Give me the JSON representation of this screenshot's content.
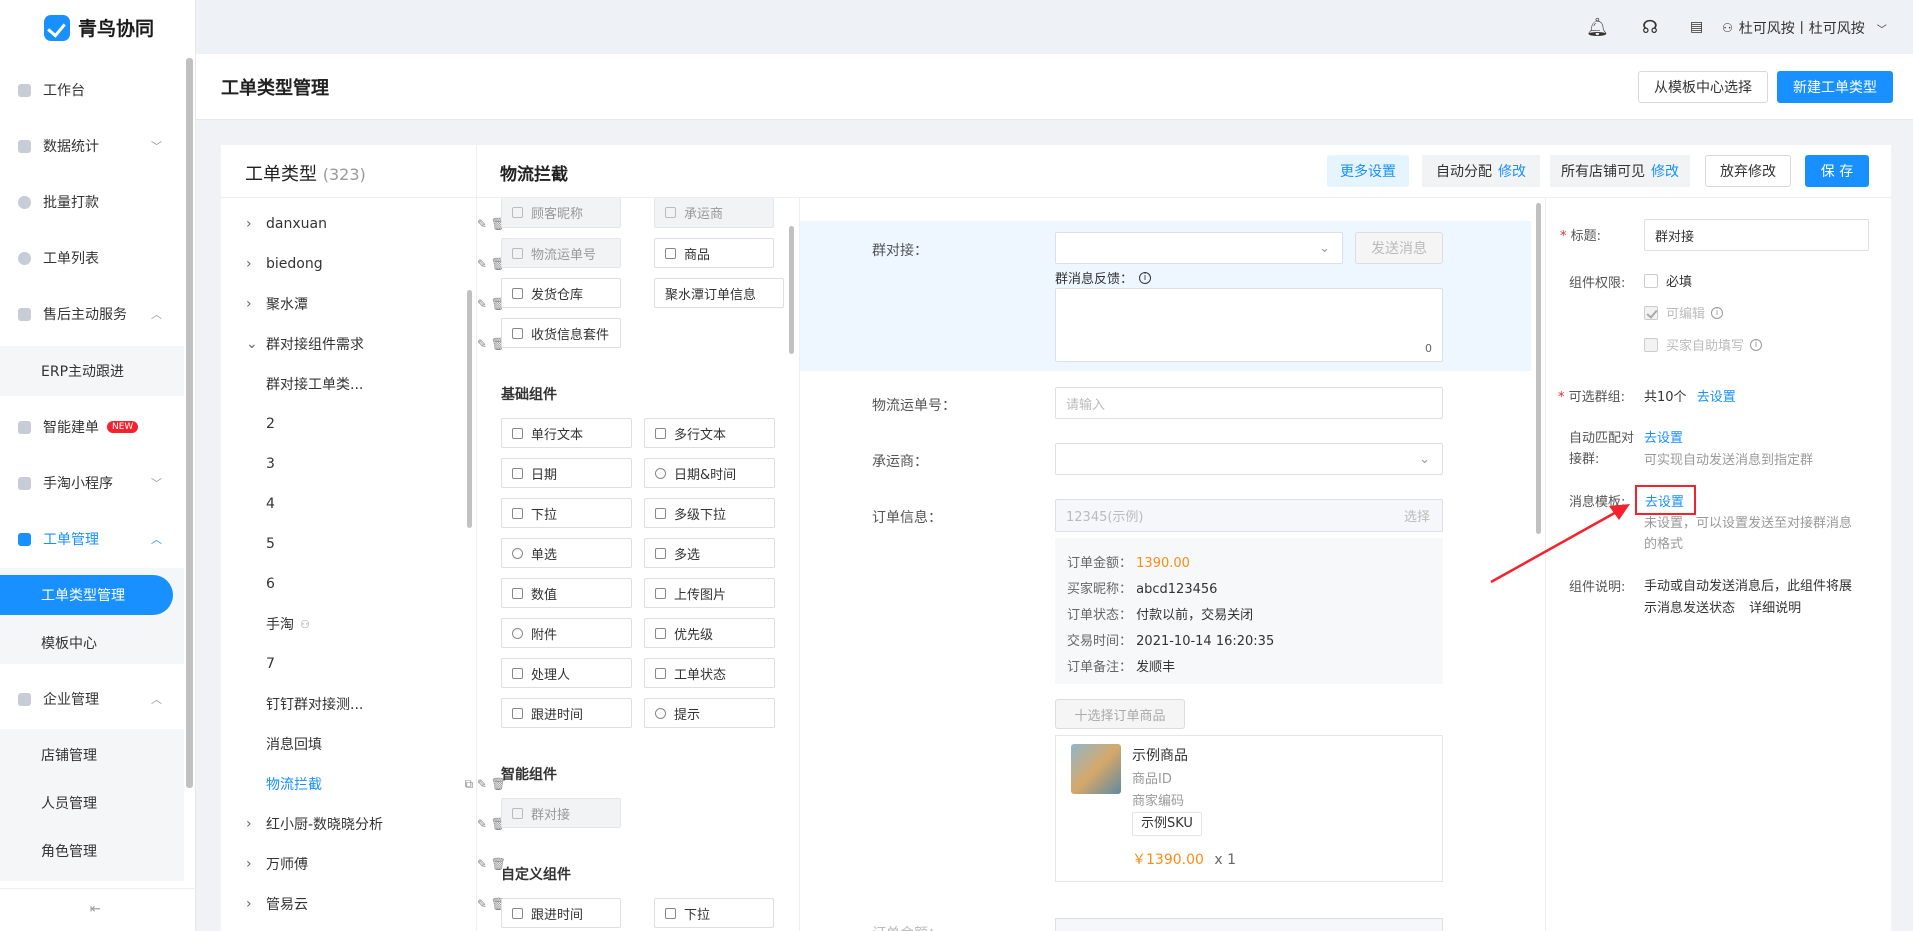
{
  "app": {
    "name": "青鸟协同"
  },
  "topbar": {
    "user": "杜可风按丨杜可风按"
  },
  "sidebar": {
    "items": [
      {
        "label": "工作台"
      },
      {
        "label": "数据统计"
      },
      {
        "label": "批量打款"
      },
      {
        "label": "工单列表"
      },
      {
        "label": "售后主动服务"
      },
      {
        "label": "ERP主动跟进"
      },
      {
        "label": "智能建单",
        "badge": "NEW"
      },
      {
        "label": "手淘小程序"
      },
      {
        "label": "工单管理"
      },
      {
        "label": "工单类型管理"
      },
      {
        "label": "模板中心"
      },
      {
        "label": "企业管理"
      },
      {
        "label": "店铺管理"
      },
      {
        "label": "人员管理"
      },
      {
        "label": "角色管理"
      }
    ]
  },
  "page": {
    "title": "工单类型管理",
    "btn_template": "从模板中心选择",
    "btn_new": "新建工单类型"
  },
  "types": {
    "title": "工单类型",
    "count": "(323)",
    "items": [
      "danxuan",
      "biedong",
      "聚水潭",
      "群对接组件需求",
      "群对接工单类...",
      "2",
      "3",
      "4",
      "5",
      "6",
      "手淘",
      "7",
      "钉钉群对接测...",
      "消息回填",
      "物流拦截",
      "红小厨-数晓晓分析",
      "万师傅",
      "管易云"
    ]
  },
  "editor": {
    "name": "物流拦截",
    "more": "更多设置",
    "auto_assign": "自动分配",
    "modify": "修改",
    "shops": "所有店铺可见",
    "discard": "放弃修改",
    "save": "保 存"
  },
  "components": {
    "top": [
      "顾客昵称",
      "承运商",
      "物流运单号",
      "商品",
      "发货仓库",
      "聚水潭订单信息",
      "收货信息套件"
    ],
    "basic_title": "基础组件",
    "basic": [
      "单行文本",
      "多行文本",
      "日期",
      "日期&时间",
      "下拉",
      "多级下拉",
      "单选",
      "多选",
      "数值",
      "上传图片",
      "附件",
      "优先级",
      "处理人",
      "工单状态",
      "跟进时间",
      "提示"
    ],
    "smart_title": "智能组件",
    "smart": [
      "群对接"
    ],
    "custom_title": "自定义组件",
    "custom": [
      "跟进时间",
      "下拉"
    ]
  },
  "form": {
    "group_label": "群对接：",
    "send_btn": "发送消息",
    "feedback_label": "群消息反馈：",
    "counter": "0",
    "tracking_label": "物流运单号：",
    "tracking_placeholder": "请输入",
    "carrier_label": "承运商：",
    "order_label": "订单信息：",
    "order_value": "12345(示例)",
    "order_select": "选择",
    "order_rows": [
      {
        "k": "订单金额：",
        "v": "1390.00"
      },
      {
        "k": "买家昵称：",
        "v": "abcd123456"
      },
      {
        "k": "订单状态：",
        "v": "付款以前，交易关闭"
      },
      {
        "k": "交易时间：",
        "v": "2021-10-14 16:20:35"
      },
      {
        "k": "订单备注：",
        "v": "发顺丰"
      }
    ],
    "select_goods": "十选择订单商品",
    "goods_name": "示例商品",
    "goods_id": "商品ID",
    "goods_code": "商家编码",
    "goods_sku": "示例SKU",
    "goods_price": "￥1390.00",
    "goods_qty": "x 1",
    "next_label": "订单金额："
  },
  "props": {
    "title_label": "标题:",
    "title_value": "群对接",
    "perm_label": "组件权限:",
    "required": "必填",
    "editable": "可编辑",
    "buyer_fill": "买家自助填写",
    "groups_label": "可选群组:",
    "groups_value": "共10个",
    "go_set": "去设置",
    "auto_match_label1": "自动匹配对",
    "auto_match_label2": "接群:",
    "auto_match_hint": "可实现自动发送消息到指定群",
    "tpl_label": "消息模板:",
    "tpl_hint1": "未设置，可以设置发送至对接群消息",
    "tpl_hint2": "的格式",
    "desc_label": "组件说明:",
    "desc1": "手动或自动发送消息后，此组件将展",
    "desc2": "示消息发送状态",
    "desc_link": "详细说明"
  },
  "colors": {
    "accent": "#1890ff",
    "price": "#fa8c16",
    "highlight": "#f5222d"
  }
}
